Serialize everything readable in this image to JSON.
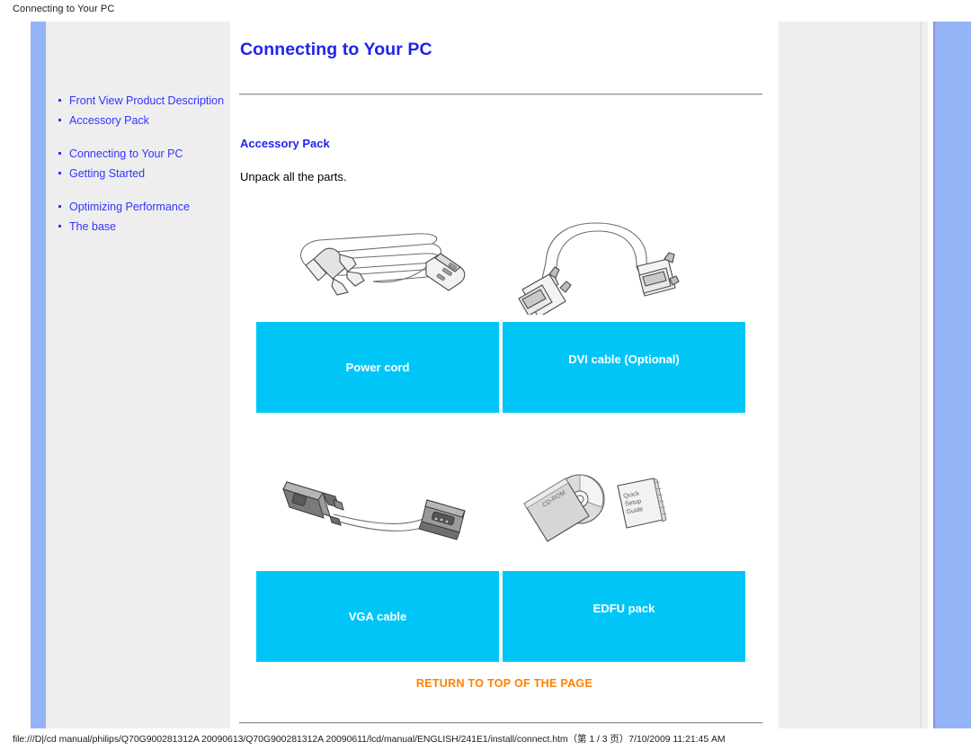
{
  "window": {
    "title": "Connecting to Your PC"
  },
  "sidebar": {
    "items": [
      {
        "label": "Front View Product Description",
        "gap": false
      },
      {
        "label": "Accessory Pack",
        "gap": false
      },
      {
        "label": "Connecting to Your PC",
        "gap": true
      },
      {
        "label": "Getting Started",
        "gap": false
      },
      {
        "label": "Optimizing Performance",
        "gap": true
      },
      {
        "label": "The base",
        "gap": false
      }
    ]
  },
  "content": {
    "heading": "Connecting to Your PC",
    "subheading": "Accessory Pack",
    "paragraph": "Unpack all the parts.",
    "return_link": "RETURN TO TOP OF THE PAGE"
  },
  "figures": [
    {
      "caption": "Power cord",
      "icon": "power-cord-illustration",
      "align": "mid"
    },
    {
      "caption": "DVI cable (Optional)",
      "icon": "dvi-cable-illustration",
      "align": "high"
    },
    {
      "caption": "VGA cable",
      "icon": "vga-cable-illustration",
      "align": "mid"
    },
    {
      "caption": "EDFU pack",
      "icon": "edfu-pack-illustration",
      "align": "high"
    }
  ],
  "edfu_labels": {
    "disc": "CD-ROM",
    "booklet_line1": "Quick",
    "booklet_line2": "Setup",
    "booklet_line3": "Guide"
  },
  "footer": {
    "status": "file:///D|/cd manual/philips/Q70G900281312A 20090613/Q70G900281312A 20090611/lcd/manual/ENGLISH/241E1/install/connect.htm（第 1 / 3 页）7/10/2009 11:21:45 AM"
  },
  "colors": {
    "link_blue": "#3333ff",
    "heading_blue": "#2222ee",
    "caption_cyan": "#00c6f8",
    "accent_band": "#94b4f7",
    "return_orange": "#ff8000"
  }
}
